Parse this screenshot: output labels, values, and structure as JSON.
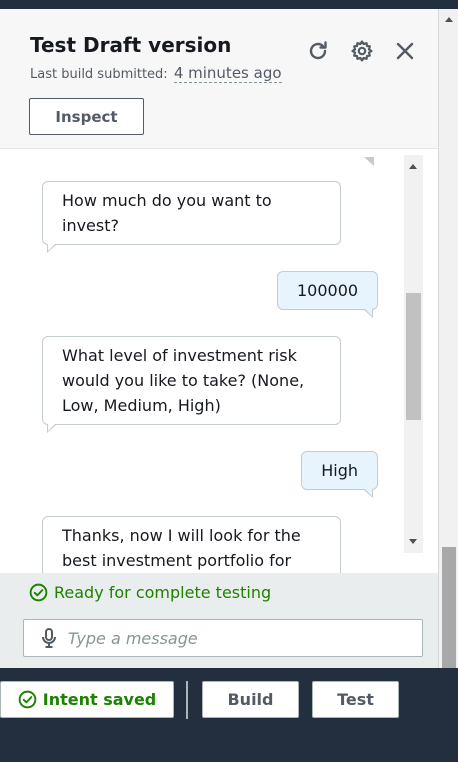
{
  "panel": {
    "title": "Test Draft version",
    "subtitle_label": "Last build submitted:",
    "subtitle_time": "4 minutes ago",
    "inspect_label": "Inspect"
  },
  "icons": {
    "refresh": "refresh-icon",
    "settings": "gear-icon",
    "close": "close-icon",
    "mic": "microphone-icon",
    "check": "check-circle-icon"
  },
  "chat": {
    "messages": [
      {
        "from": "bot",
        "text": "How much do you want to invest?"
      },
      {
        "from": "user",
        "text": "100000"
      },
      {
        "from": "bot",
        "text": "What level of investment risk would you like to take? (None, Low, Medium, High)"
      },
      {
        "from": "user",
        "text": "High"
      },
      {
        "from": "bot",
        "text": "Thanks, now I will look for the best investment portfolio for"
      }
    ]
  },
  "status": {
    "text": "Ready for complete testing",
    "color": "#1d8102"
  },
  "input": {
    "placeholder": "Type a message"
  },
  "footer": {
    "saved_label": "Intent saved",
    "build_label": "Build",
    "test_label": "Test"
  },
  "colors": {
    "accent_green": "#1d8102",
    "dark_bg": "#232f3e",
    "user_bubble": "#e8f4fd"
  }
}
